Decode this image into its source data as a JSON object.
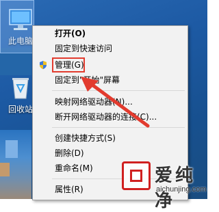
{
  "desktop": {
    "icons": [
      {
        "label": "此电脑"
      },
      {
        "label": "回收站"
      }
    ]
  },
  "context_menu": {
    "items": [
      {
        "label": "打开(O)",
        "bold": true
      },
      {
        "label": "固定到快速访问"
      },
      {
        "label": "管理(G)",
        "icon": "shield-icon",
        "highlighted": true
      },
      {
        "label": "固定到\"开始\"屏幕"
      },
      {
        "label": "映射网络驱动器(N)..."
      },
      {
        "label": "断开网络驱动器的连接(C)..."
      },
      {
        "label": "创建快捷方式(S)"
      },
      {
        "label": "删除(D)"
      },
      {
        "label": "重命名(M)"
      },
      {
        "label": "属性(R)"
      }
    ]
  },
  "annotation": {
    "highlight_color": "#e23b2e",
    "arrow_color": "#e23b2e"
  },
  "watermark": {
    "text": "爱纯净",
    "url": "aichunjing.com"
  }
}
